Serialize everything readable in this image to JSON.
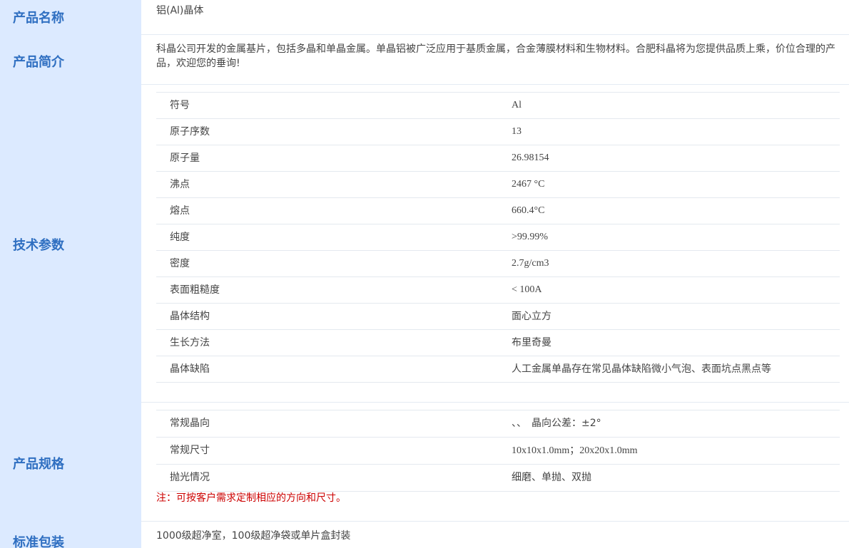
{
  "labels": {
    "name": "产品名称",
    "intro": "产品简介",
    "specs": "技术参数",
    "format": "产品规格",
    "packaging": "标准包装"
  },
  "product_name": "铝(Al)晶体",
  "intro": "科晶公司开发的金属基片，包括多晶和单晶金属。单晶铝被广泛应用于基质金属，合金薄膜材料和生物材料。合肥科晶将为您提供品质上乘，价位合理的产品，欢迎您的垂询!",
  "specs": [
    {
      "key": "符号",
      "value": "Al"
    },
    {
      "key": "原子序数",
      "value": "13"
    },
    {
      "key": "原子量",
      "value": "26.98154"
    },
    {
      "key": "沸点",
      "value": "2467 °C"
    },
    {
      "key": "熔点",
      "value": "660.4°C"
    },
    {
      "key": "纯度",
      "value": ">99.99%"
    },
    {
      "key": "密度",
      "value": "2.7g/cm3"
    },
    {
      "key": "表面粗糙度",
      "value": "< 100A"
    },
    {
      "key": "晶体结构",
      "value": "面心立方"
    },
    {
      "key": "生长方法",
      "value": "布里奇曼"
    },
    {
      "key": "晶体缺陷",
      "value": "人工金属单晶存在常见晶体缺陷微小气泡、表面坑点黑点等"
    }
  ],
  "format": [
    {
      "key": "常规晶向",
      "value": "、、　晶向公差：±2°"
    },
    {
      "key": "常规尺寸",
      "value": "10x10x1.0mm；20x20x1.0mm"
    },
    {
      "key": "抛光情况",
      "value": "细磨、单抛、双抛"
    }
  ],
  "note": "注：可按客户需求定制相应的方向和尺寸。",
  "packaging": "1000级超净室，100级超净袋或单片盒封装"
}
